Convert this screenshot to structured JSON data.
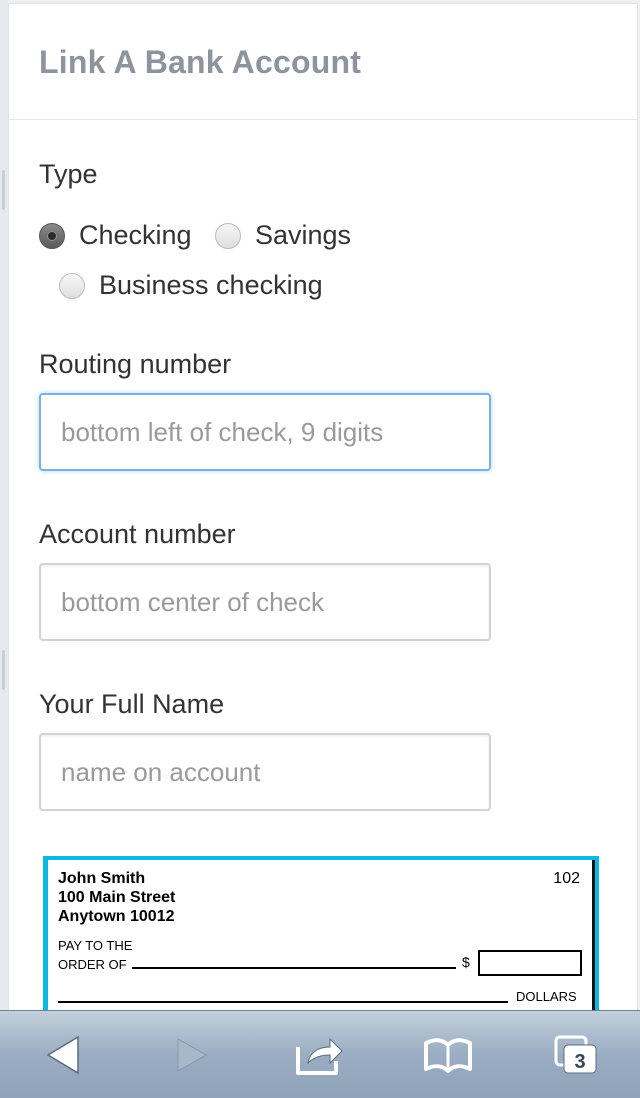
{
  "modal": {
    "title": "Link A Bank Account"
  },
  "form": {
    "type": {
      "label": "Type",
      "options": [
        {
          "label": "Checking",
          "checked": true
        },
        {
          "label": "Savings",
          "checked": false
        },
        {
          "label": "Business checking",
          "checked": false
        }
      ]
    },
    "routing": {
      "label": "Routing number",
      "placeholder": "bottom left of check, 9 digits",
      "value": ""
    },
    "account": {
      "label": "Account number",
      "placeholder": "bottom center of check",
      "value": ""
    },
    "full_name": {
      "label": "Your Full Name",
      "placeholder": "name on account",
      "value": ""
    }
  },
  "check_image": {
    "name": "John Smith",
    "street": "100 Main Street",
    "city": "Anytown 10012",
    "number": "102",
    "pay_to_line1": "PAY TO THE",
    "pay_to_line2": "ORDER OF",
    "dollar_sign": "$",
    "dollars_label": "DOLLARS",
    "accent_color": "#0bb7e4"
  },
  "toolbar": {
    "back_icon": "back-arrow-icon",
    "forward_icon": "forward-arrow-icon",
    "share_icon": "share-icon",
    "bookmarks_icon": "bookmarks-book-icon",
    "tabs_icon": "tabs-icon",
    "tabs_count": "3"
  }
}
